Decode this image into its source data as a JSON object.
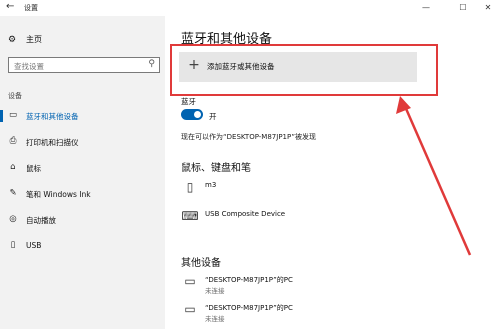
{
  "window": {
    "title": "设置",
    "back_icon": "back-arrow-icon",
    "minimize": "—",
    "maximize": "☐",
    "close": "✕"
  },
  "sidebar": {
    "home_label": "主页",
    "search_placeholder": "查找设置",
    "section_label": "设备",
    "items": [
      {
        "label": "蓝牙和其他设备",
        "icon": "bluetooth-devices-icon",
        "glyph": "▭",
        "active": true
      },
      {
        "label": "打印机和扫描仪",
        "icon": "printer-icon",
        "glyph": "⎙",
        "active": false
      },
      {
        "label": "鼠标",
        "icon": "mouse-icon",
        "glyph": "⌂",
        "active": false
      },
      {
        "label": "笔和 Windows Ink",
        "icon": "pen-icon",
        "glyph": "✎",
        "active": false
      },
      {
        "label": "自动播放",
        "icon": "autoplay-icon",
        "glyph": "◎",
        "active": false
      },
      {
        "label": "USB",
        "icon": "usb-icon",
        "glyph": "▯",
        "active": false
      }
    ]
  },
  "main": {
    "title": "蓝牙和其他设备",
    "add_device_label": "添加蓝牙或其他设备",
    "add_device_glyph": "+",
    "bluetooth_label": "蓝牙",
    "bluetooth_state": "开",
    "bluetooth_on": true,
    "discoverable_text": "现在可以作为“DESKTOP-M87JP1P”被发现",
    "section_mouse_keyboard_pen": "鼠标、键盘和笔",
    "input_devices": [
      {
        "name": "m3",
        "status": "",
        "icon": "mouse-device-icon",
        "glyph": "▯"
      },
      {
        "name": "USB Composite Device",
        "status": "",
        "icon": "keyboard-icon",
        "glyph": "⌨"
      }
    ],
    "section_other_devices": "其他设备",
    "other_devices": [
      {
        "name": "“DESKTOP-M87JP1P”的PC",
        "status": "未连接",
        "icon": "pc-device-icon",
        "glyph": "▭"
      },
      {
        "name": "“DESKTOP-M87JP1P”的PC",
        "status": "未连接",
        "icon": "pc-device-icon",
        "glyph": "▭"
      }
    ]
  },
  "annotation": {
    "color": "#e03a3a"
  },
  "colors": {
    "accent": "#0063b1",
    "sidebar_bg": "#f2f2f2",
    "button_bg": "#e6e6e6"
  }
}
